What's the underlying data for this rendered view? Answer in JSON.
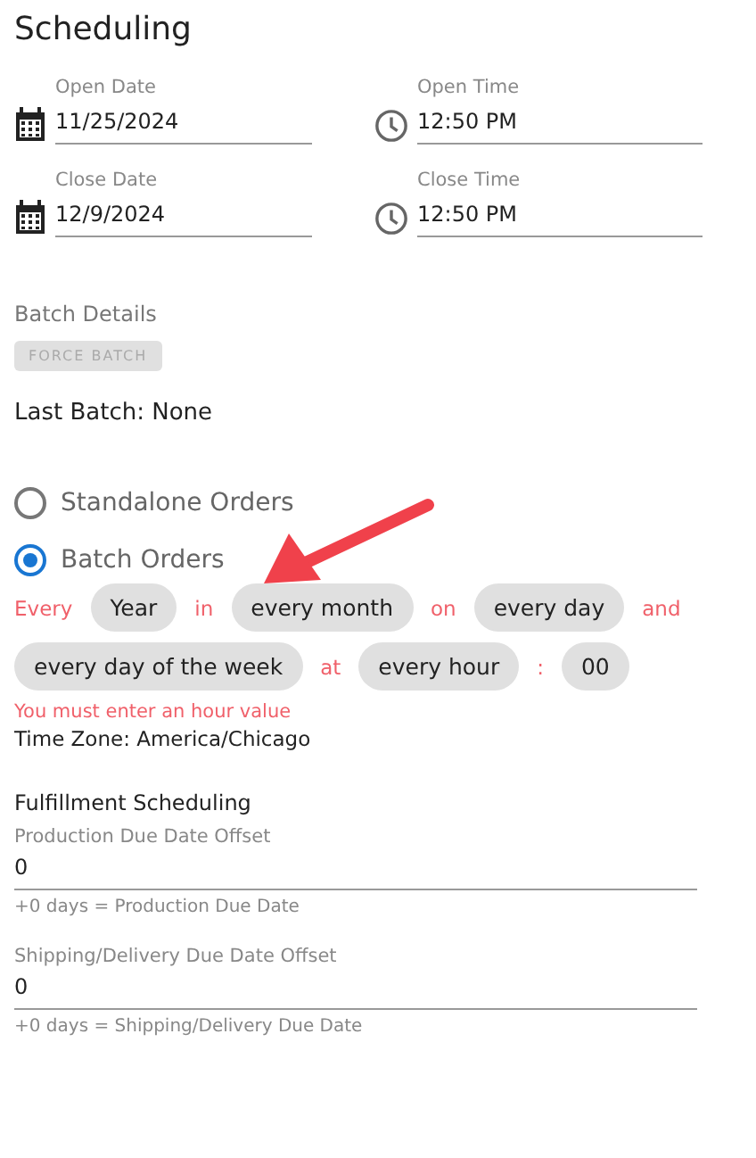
{
  "title": "Scheduling",
  "datetime_fields": [
    {
      "kind": "date",
      "label": "Open Date",
      "value": "11/25/2024"
    },
    {
      "kind": "time",
      "label": "Open Time",
      "value": "12:50 PM"
    },
    {
      "kind": "date",
      "label": "Close Date",
      "value": "12/9/2024"
    },
    {
      "kind": "time",
      "label": "Close Time",
      "value": "12:50 PM"
    }
  ],
  "batch_details": {
    "heading": "Batch Details",
    "button": {
      "label": "FORCE BATCH",
      "disabled": true
    },
    "last_batch": "Last Batch: None"
  },
  "order_types": [
    {
      "label": "Standalone Orders",
      "selected": false
    },
    {
      "label": "Batch Orders",
      "selected": true
    }
  ],
  "schedule": [
    {
      "kind": "word",
      "text": "Every"
    },
    {
      "kind": "chip",
      "text": "Year"
    },
    {
      "kind": "word",
      "text": "in"
    },
    {
      "kind": "chip",
      "text": "every month"
    },
    {
      "kind": "word",
      "text": "on"
    },
    {
      "kind": "chip",
      "text": "every day"
    },
    {
      "kind": "word",
      "text": "and"
    },
    {
      "kind": "chip",
      "text": "every day of the week"
    },
    {
      "kind": "word",
      "text": "at"
    },
    {
      "kind": "chip",
      "text": "every hour"
    },
    {
      "kind": "word",
      "text": ":"
    },
    {
      "kind": "chip",
      "text": "00"
    }
  ],
  "schedule_error": "You must enter an hour value",
  "time_zone": "Time Zone: America/Chicago",
  "fulfillment": {
    "heading": "Fulfillment Scheduling",
    "fields": [
      {
        "label": "Production Due Date Offset",
        "value": "0",
        "helper": "+0 days = Production Due Date"
      },
      {
        "label": "Shipping/Delivery Due Date Offset",
        "value": "0",
        "helper": "+0 days = Shipping/Delivery Due Date"
      }
    ]
  }
}
